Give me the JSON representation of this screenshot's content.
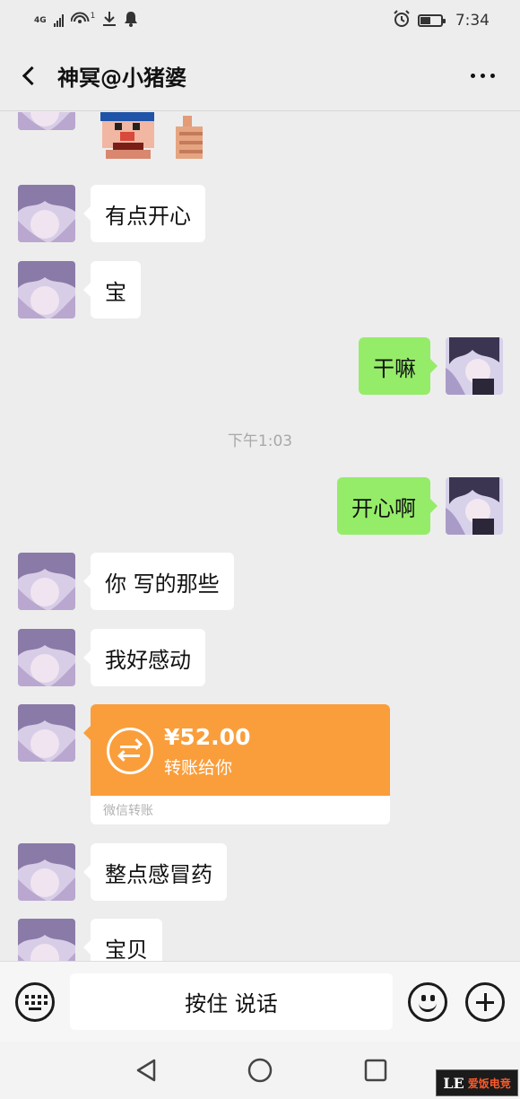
{
  "status_bar": {
    "network": "4G",
    "wifi_badge": "1",
    "time": "7:34"
  },
  "header": {
    "title": "神冥@小猪婆"
  },
  "messages": [
    {
      "dir": "in",
      "text": "有点开心"
    },
    {
      "dir": "in",
      "text": "宝"
    },
    {
      "dir": "out",
      "text": "干嘛"
    },
    {
      "type": "time",
      "text": "下午1:03"
    },
    {
      "dir": "out",
      "text": "开心啊"
    },
    {
      "dir": "in",
      "text": "你 写的那些"
    },
    {
      "dir": "in",
      "text": "我好感动"
    },
    {
      "dir": "in",
      "text": "整点感冒药"
    },
    {
      "dir": "in",
      "text": "宝贝"
    }
  ],
  "transfer": {
    "amount": "¥52.00",
    "note": "转账给你",
    "source": "微信转账"
  },
  "input_bar": {
    "talk_label": "按住 说话"
  },
  "watermark": {
    "logo": "LE",
    "text": "爱饭电竞"
  },
  "colors": {
    "background": "#ededed",
    "bubble_in": "#ffffff",
    "bubble_out": "#95ec69",
    "transfer": "#fa9e3b",
    "timestamp": "#a8a8a8"
  },
  "icons": [
    "back-arrow-icon",
    "more-icon",
    "keyboard-icon",
    "emoji-icon",
    "plus-icon",
    "transfer-icon",
    "nav-back-icon",
    "nav-home-icon",
    "nav-recent-icon"
  ]
}
